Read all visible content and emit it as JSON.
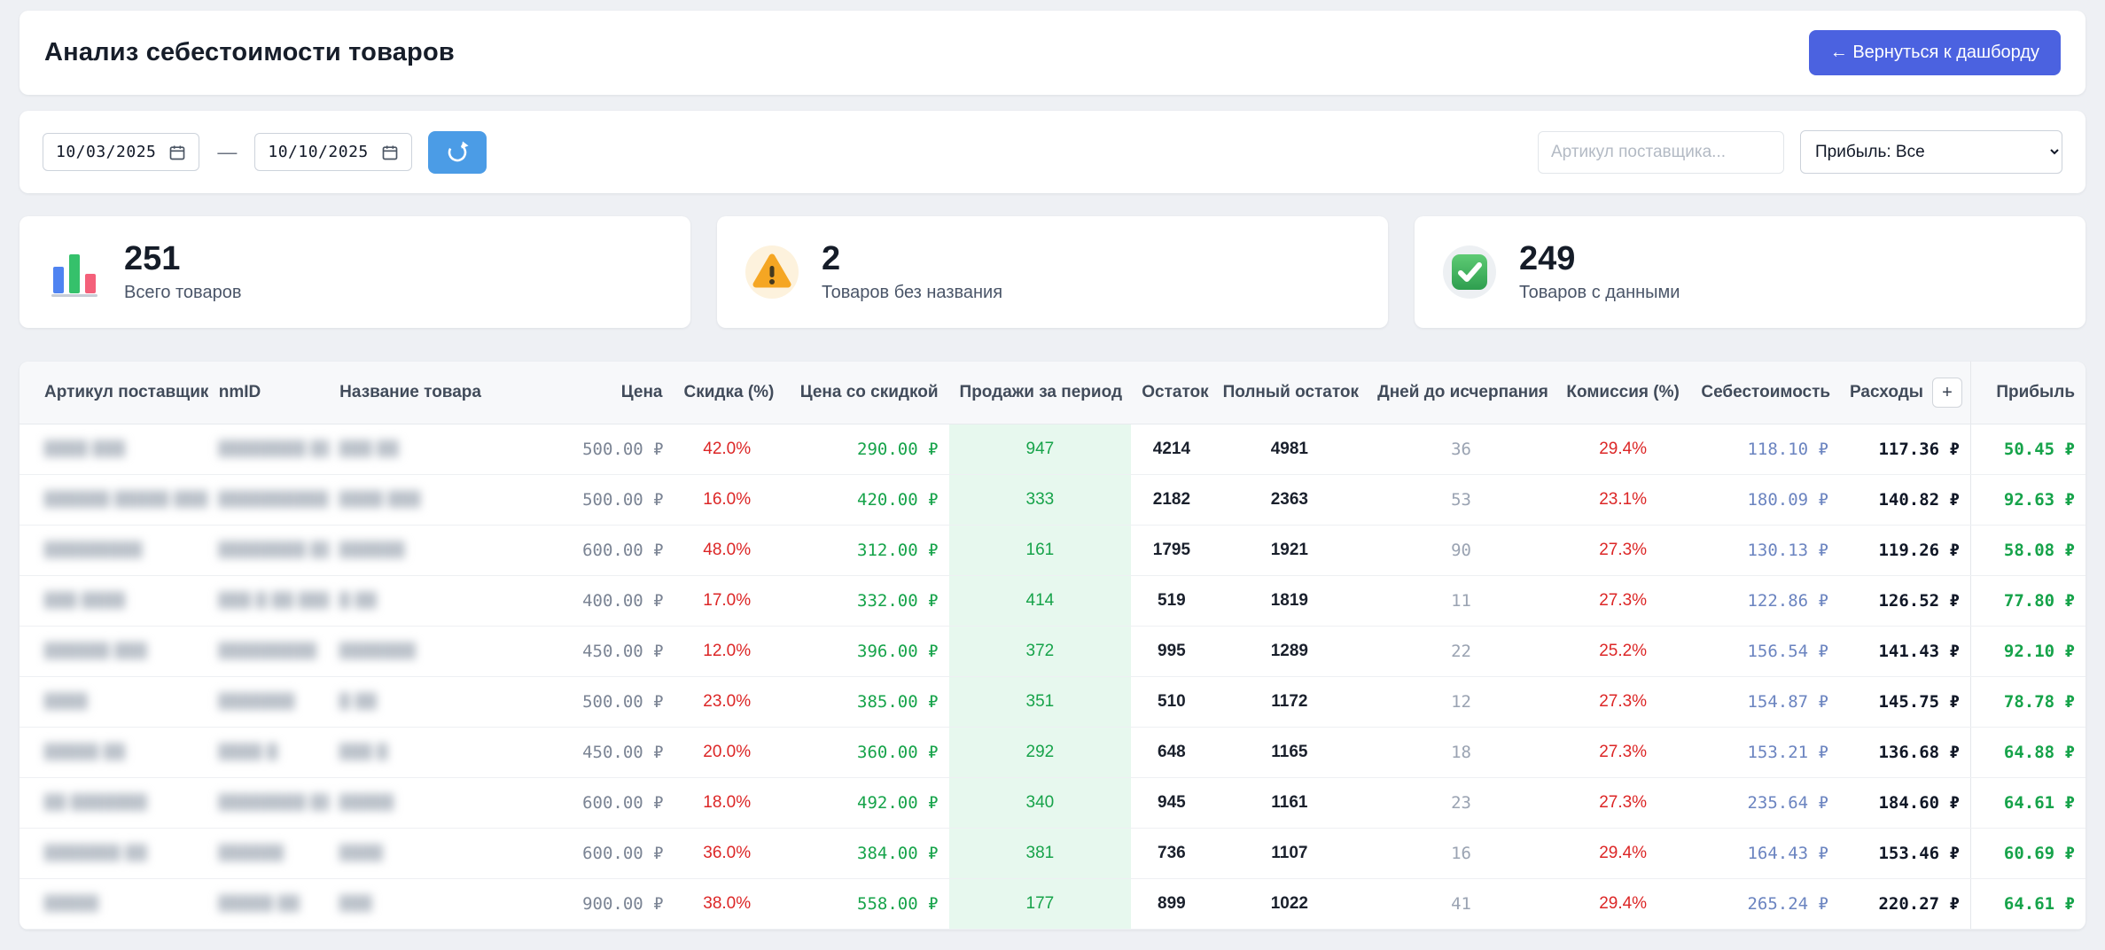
{
  "header": {
    "title": "Анализ себестоимости товаров",
    "back_button": "← Вернуться к дашборду"
  },
  "filters": {
    "date_from": "10/03/2025",
    "date_to": "10/10/2025",
    "separator": "—",
    "refresh_icon": "refresh-icon",
    "calendar_icon": "calendar-icon",
    "search_placeholder": "Артикул поставщика...",
    "profit_filter": "Прибыль: Все"
  },
  "stats": [
    {
      "value": "251",
      "label": "Всего товаров",
      "icon": "bar-chart-icon"
    },
    {
      "value": "2",
      "label": "Товаров без названия",
      "icon": "warning-triangle-icon"
    },
    {
      "value": "249",
      "label": "Товаров с данными",
      "icon": "check-square-icon"
    }
  ],
  "table": {
    "columns": [
      "Артикул поставщика",
      "nmID",
      "Название товара",
      "Цена",
      "Скидка (%)",
      "Цена со скидкой",
      "Продажи за период",
      "Остаток",
      "Полный остаток",
      "Дней до исчерпания",
      "Комиссия (%)",
      "Себестоимость",
      "Расходы",
      "Прибыль"
    ],
    "expand_button": "+",
    "rows": [
      {
        "article": "████ ███",
        "nmid": "████████ ██",
        "name": "███ ██",
        "price": "500.00 ₽",
        "discount": "42.0%",
        "discount_price": "290.00 ₽",
        "sales": "947",
        "stock": "4214",
        "full_stock": "4981",
        "days": "36",
        "commission": "29.4%",
        "cost": "118.10 ₽",
        "expenses": "117.36 ₽",
        "profit": "50.45 ₽"
      },
      {
        "article": "██████ █████ ████",
        "nmid": "██████████████",
        "name": "████ ███",
        "price": "500.00 ₽",
        "discount": "16.0%",
        "discount_price": "420.00 ₽",
        "sales": "333",
        "stock": "2182",
        "full_stock": "2363",
        "days": "53",
        "commission": "23.1%",
        "cost": "180.09 ₽",
        "expenses": "140.82 ₽",
        "profit": "92.63 ₽"
      },
      {
        "article": "█████████",
        "nmid": "████████ ██",
        "name": "██████",
        "price": "600.00 ₽",
        "discount": "48.0%",
        "discount_price": "312.00 ₽",
        "sales": "161",
        "stock": "1795",
        "full_stock": "1921",
        "days": "90",
        "commission": "27.3%",
        "cost": "130.13 ₽",
        "expenses": "119.26 ₽",
        "profit": "58.08 ₽"
      },
      {
        "article": "███ ████",
        "nmid": "███ █ ██ █████ ███",
        "name": "█ ██",
        "price": "400.00 ₽",
        "discount": "17.0%",
        "discount_price": "332.00 ₽",
        "sales": "414",
        "stock": "519",
        "full_stock": "1819",
        "days": "11",
        "commission": "27.3%",
        "cost": "122.86 ₽",
        "expenses": "126.52 ₽",
        "profit": "77.80 ₽"
      },
      {
        "article": "██████ ███",
        "nmid": "█████████",
        "name": "███████",
        "price": "450.00 ₽",
        "discount": "12.0%",
        "discount_price": "396.00 ₽",
        "sales": "372",
        "stock": "995",
        "full_stock": "1289",
        "days": "22",
        "commission": "25.2%",
        "cost": "156.54 ₽",
        "expenses": "141.43 ₽",
        "profit": "92.10 ₽"
      },
      {
        "article": "████",
        "nmid": "███████",
        "name": "█ ██",
        "price": "500.00 ₽",
        "discount": "23.0%",
        "discount_price": "385.00 ₽",
        "sales": "351",
        "stock": "510",
        "full_stock": "1172",
        "days": "12",
        "commission": "27.3%",
        "cost": "154.87 ₽",
        "expenses": "145.75 ₽",
        "profit": "78.78 ₽"
      },
      {
        "article": "█████ ██",
        "nmid": "████ █",
        "name": "███ █",
        "price": "450.00 ₽",
        "discount": "20.0%",
        "discount_price": "360.00 ₽",
        "sales": "292",
        "stock": "648",
        "full_stock": "1165",
        "days": "18",
        "commission": "27.3%",
        "cost": "153.21 ₽",
        "expenses": "136.68 ₽",
        "profit": "64.88 ₽"
      },
      {
        "article": "██ ███████",
        "nmid": "████████ ███",
        "name": "█████",
        "price": "600.00 ₽",
        "discount": "18.0%",
        "discount_price": "492.00 ₽",
        "sales": "340",
        "stock": "945",
        "full_stock": "1161",
        "days": "23",
        "commission": "27.3%",
        "cost": "235.64 ₽",
        "expenses": "184.60 ₽",
        "profit": "64.61 ₽"
      },
      {
        "article": "███████ ██",
        "nmid": "██████",
        "name": "████",
        "price": "600.00 ₽",
        "discount": "36.0%",
        "discount_price": "384.00 ₽",
        "sales": "381",
        "stock": "736",
        "full_stock": "1107",
        "days": "16",
        "commission": "29.4%",
        "cost": "164.43 ₽",
        "expenses": "153.46 ₽",
        "profit": "60.69 ₽"
      },
      {
        "article": "█████",
        "nmid": "█████ ██",
        "name": "███",
        "price": "900.00 ₽",
        "discount": "38.0%",
        "discount_price": "558.00 ₽",
        "sales": "177",
        "stock": "899",
        "full_stock": "1022",
        "days": "41",
        "commission": "29.4%",
        "cost": "265.24 ₽",
        "expenses": "220.27 ₽",
        "profit": "64.61 ₽"
      }
    ]
  }
}
